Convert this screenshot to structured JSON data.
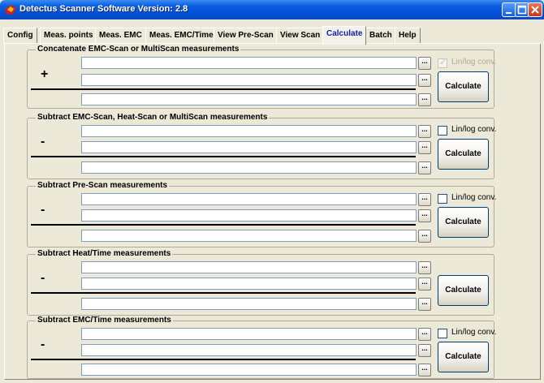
{
  "window": {
    "title": "Detectus Scanner Software Version: 2.8"
  },
  "tabs": [
    {
      "label": "Config"
    },
    {
      "label": "Meas. points"
    },
    {
      "label": "Meas. EMC"
    },
    {
      "label": "Meas. EMC/Time"
    },
    {
      "label": "View Pre-Scan"
    },
    {
      "label": "View Scan"
    },
    {
      "label": "Calculate",
      "active": true
    },
    {
      "label": "Batch"
    },
    {
      "label": "Help"
    }
  ],
  "groups": [
    {
      "title": "Concatenate EMC-Scan or MultiScan measurements",
      "operator": "+",
      "fields": [
        "",
        "",
        ""
      ],
      "checkbox_label": "Lin/log conv.",
      "checkbox_checked": true,
      "checkbox_disabled": true,
      "calculate_label": "Calculate",
      "browse_label": "..."
    },
    {
      "title": "Subtract EMC-Scan, Heat-Scan or MultiScan measurements",
      "operator": "-",
      "fields": [
        "",
        "",
        ""
      ],
      "checkbox_label": "Lin/log conv.",
      "checkbox_checked": false,
      "checkbox_disabled": false,
      "calculate_label": "Calculate",
      "browse_label": "..."
    },
    {
      "title": "Subtract Pre-Scan measurements",
      "operator": "-",
      "fields": [
        "",
        "",
        ""
      ],
      "checkbox_label": "Lin/log conv.",
      "checkbox_checked": false,
      "checkbox_disabled": false,
      "calculate_label": "Calculate",
      "browse_label": "..."
    },
    {
      "title": "Subtract Heat/Time measurements",
      "operator": "-",
      "fields": [
        "",
        "",
        ""
      ],
      "checkbox_label": "",
      "calculate_label": "Calculate",
      "browse_label": "..."
    },
    {
      "title": "Subtract EMC/Time measurements",
      "operator": "-",
      "fields": [
        "",
        "",
        ""
      ],
      "checkbox_label": "Lin/log conv.",
      "checkbox_checked": false,
      "checkbox_disabled": false,
      "calculate_label": "Calculate",
      "browse_label": "..."
    }
  ],
  "colors": {
    "titlebar": "#0450d5",
    "active_tab_text": "#0a1faa",
    "window_bg": "#ece9d8"
  }
}
